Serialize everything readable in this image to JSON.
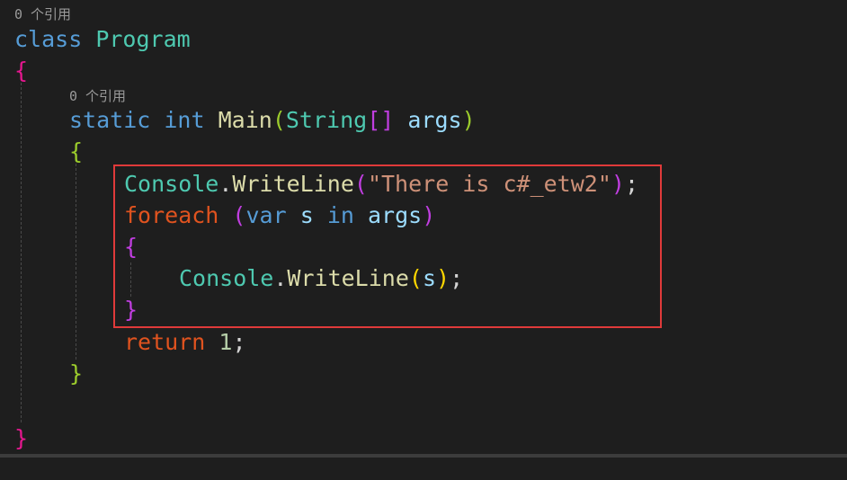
{
  "code_lens": {
    "class_refs": "0 个引用",
    "method_refs": "0 个引用"
  },
  "code": {
    "class_keyword": "class",
    "class_name": "Program",
    "open_brace_class": "{",
    "close_brace_class": "}",
    "static_keyword": "static",
    "int_keyword": "int",
    "method_name": "Main",
    "param_type": "String",
    "param_array": "[]",
    "param_name": "args",
    "open_brace_method": "{",
    "close_brace_method": "}",
    "console_1": "Console",
    "writeline_1": "WriteLine",
    "string_literal": "\"There is c#_etw2\"",
    "foreach_keyword": "foreach",
    "var_keyword": "var",
    "loop_var": "s",
    "in_keyword": "in",
    "loop_source": "args",
    "open_brace_loop": "{",
    "close_brace_loop": "}",
    "console_2": "Console",
    "writeline_2": "WriteLine",
    "writeline_2_arg": "s",
    "return_keyword": "return",
    "return_value": "1"
  },
  "colors": {
    "background": "#1e1e1e",
    "keyword": "#569cd6",
    "control_keyword": "#e0531f",
    "type": "#4ec9b0",
    "method": "#dcdcaa",
    "variable": "#9cdcfe",
    "string": "#ce9178",
    "number": "#b5cea8",
    "highlight_border": "#e03a3a"
  }
}
